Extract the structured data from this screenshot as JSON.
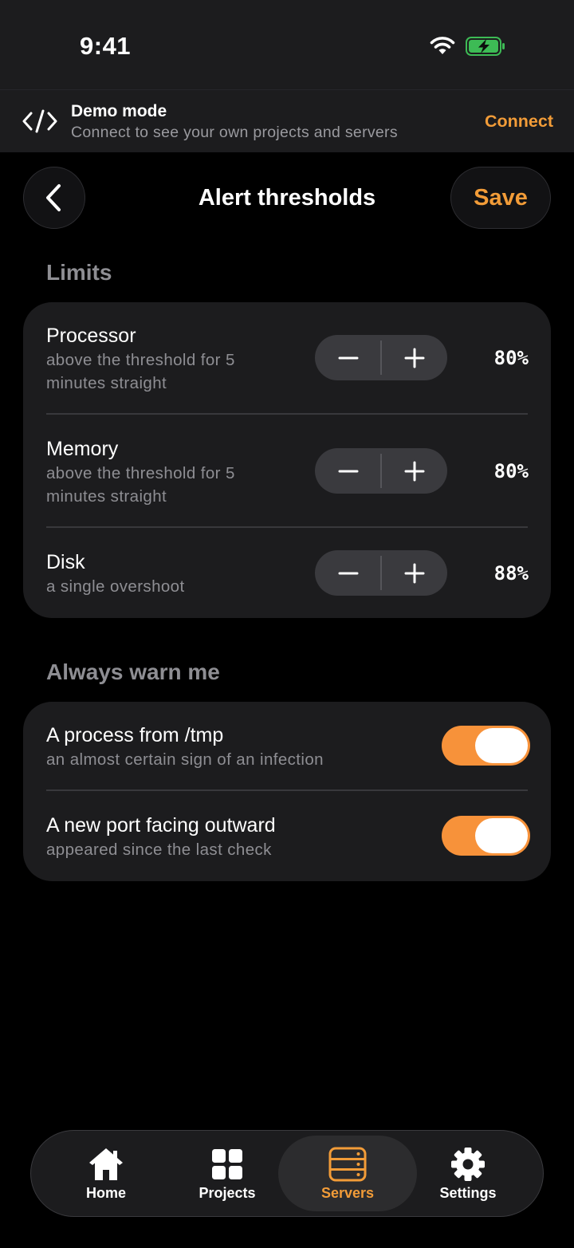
{
  "status_bar": {
    "time": "9:41"
  },
  "banner": {
    "icon": "code-icon",
    "title": "Demo mode",
    "subtitle": "Connect to see your own projects and servers",
    "connect_label": "Connect"
  },
  "header": {
    "back_icon": "chevron-left-icon",
    "title": "Alert thresholds",
    "save_label": "Save"
  },
  "limits": {
    "heading": "Limits",
    "items": [
      {
        "label": "Processor",
        "description_lines": [
          "above the threshold for 5",
          "minutes straight"
        ],
        "value": "80%"
      },
      {
        "label": "Memory",
        "description_lines": [
          "above the threshold for 5",
          "minutes straight"
        ],
        "value": "80%"
      },
      {
        "label": "Disk",
        "description_lines": [
          "a single overshoot"
        ],
        "value": "88%"
      }
    ]
  },
  "warnings": {
    "heading": "Always warn me",
    "items": [
      {
        "label": "A process from /tmp",
        "description": "an almost certain sign of an infection",
        "enabled": true
      },
      {
        "label": "A new port facing outward",
        "description": "appeared since the last check",
        "enabled": true
      }
    ]
  },
  "tab_bar": {
    "tabs": [
      {
        "label": "Home",
        "icon": "house-icon",
        "active": false
      },
      {
        "label": "Projects",
        "icon": "grid-icon",
        "active": false
      },
      {
        "label": "Servers",
        "icon": "server-icon",
        "active": true
      },
      {
        "label": "Settings",
        "icon": "gear-icon",
        "active": false
      }
    ]
  },
  "colors": {
    "accent": "#f29c38",
    "toggle_on": "#f7923a",
    "background": "#000000",
    "card": "#1c1c1e",
    "secondary_text": "#8e8e93"
  }
}
